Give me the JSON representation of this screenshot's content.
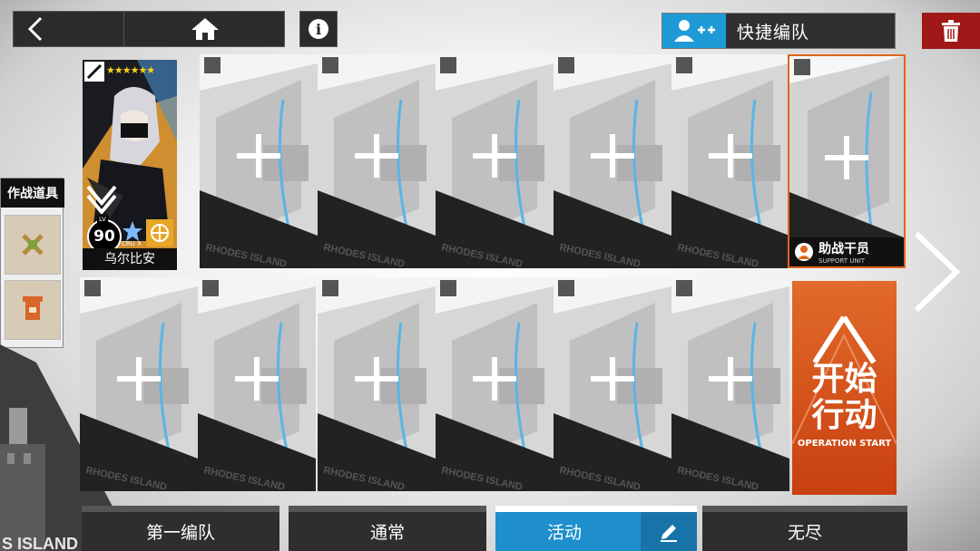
{
  "topbar": {
    "back_icon": "chevron-left-icon",
    "home_icon": "home-icon",
    "info_label": "i",
    "quick_formation_label": "快捷编队",
    "quick_formation_icon": "user-add-icon",
    "trash_icon": "trash-icon"
  },
  "items_panel": {
    "title": "作战道具"
  },
  "operator": {
    "name": "乌尔比安",
    "level": "90",
    "level_label": "LV",
    "stars": "★★★★★★",
    "potential_label": "CRU X"
  },
  "slots": {
    "empty_text": "RHODES ISLAND",
    "support_cn": "助战干员",
    "support_en": "SUPPORT UNIT"
  },
  "start_button": {
    "line1": "开始",
    "line2": "行动",
    "en": "OPERATION START"
  },
  "tabs": [
    {
      "label": "第一编队"
    },
    {
      "label": "通常"
    },
    {
      "label": "活动"
    },
    {
      "label": "无尽"
    }
  ],
  "colors": {
    "accent_blue": "#1e8fcc",
    "accent_orange": "#e0651d",
    "danger_red": "#a01818"
  }
}
